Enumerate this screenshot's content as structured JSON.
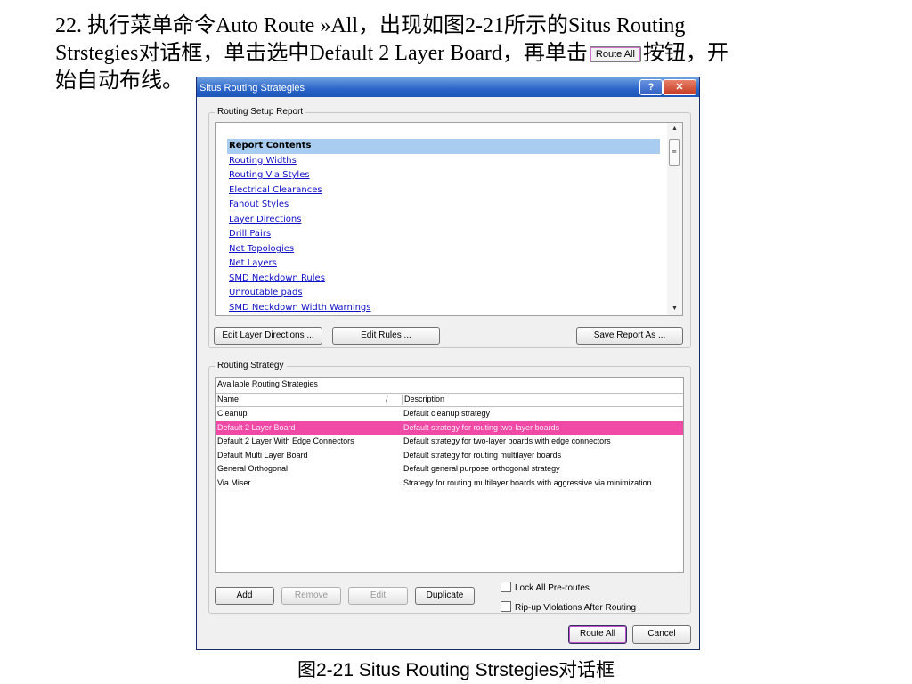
{
  "intro": {
    "line1": "22. 执行菜单命令Auto Route »All，出现如图2-21所示的Situs Routing",
    "line2a": "Strstegies对话框，单击选中Default 2 Layer Board，再单击",
    "inline_button": "Route All",
    "line2b": "按钮，开",
    "line3": "始自动布线。"
  },
  "dialog": {
    "title": "Situs Routing Strategies",
    "help_label": "?",
    "close_label": "✕",
    "report_group_label": "Routing Setup Report",
    "report_items": {
      "header": "Report Contents",
      "links": [
        "Routing Widths",
        "Routing Via Styles",
        "Electrical Clearances",
        "Fanout Styles",
        "Layer Directions",
        "Drill Pairs",
        "Net Topologies",
        "Net Layers",
        "SMD Neckdown Rules",
        "Unroutable pads",
        "SMD Neckdown Width Warnings"
      ]
    },
    "report_buttons": {
      "edit_layer_directions": "Edit Layer Directions ...",
      "edit_rules": "Edit Rules ...",
      "save_report": "Save Report As ..."
    },
    "strategy_group_label": "Routing Strategy",
    "strategy_caption": "Available Routing Strategies",
    "columns": {
      "name": "Name",
      "sort": "/",
      "description": "Description"
    },
    "strategies": [
      {
        "name": "Cleanup",
        "description": "Default cleanup strategy"
      },
      {
        "name": "Default 2 Layer Board",
        "description": "Default strategy for routing two-layer boards"
      },
      {
        "name": "Default 2 Layer With Edge Connectors",
        "description": "Default strategy for two-layer boards with edge connectors"
      },
      {
        "name": "Default Multi Layer Board",
        "description": "Default strategy for routing multilayer boards"
      },
      {
        "name": "General Orthogonal",
        "description": "Default general purpose orthogonal strategy"
      },
      {
        "name": "Via Miser",
        "description": "Strategy for routing multilayer boards with aggressive via minimization"
      }
    ],
    "selected_index": 1,
    "strategy_buttons": {
      "add": "Add",
      "remove": "Remove",
      "edit": "Edit",
      "duplicate": "Duplicate"
    },
    "checkboxes": {
      "lock_preroutes": "Lock All Pre-routes",
      "ripup_violations": "Rip-up Violations After Routing"
    },
    "footer_buttons": {
      "route_all": "Route All",
      "cancel": "Cancel"
    }
  },
  "caption": "图2-21 Situs Routing Strstegies对话框",
  "colors": {
    "selection": "#f04aa6",
    "report_header_bg": "#a8cdf0",
    "link": "#1010c8",
    "titlebar": "#2a64c8"
  }
}
